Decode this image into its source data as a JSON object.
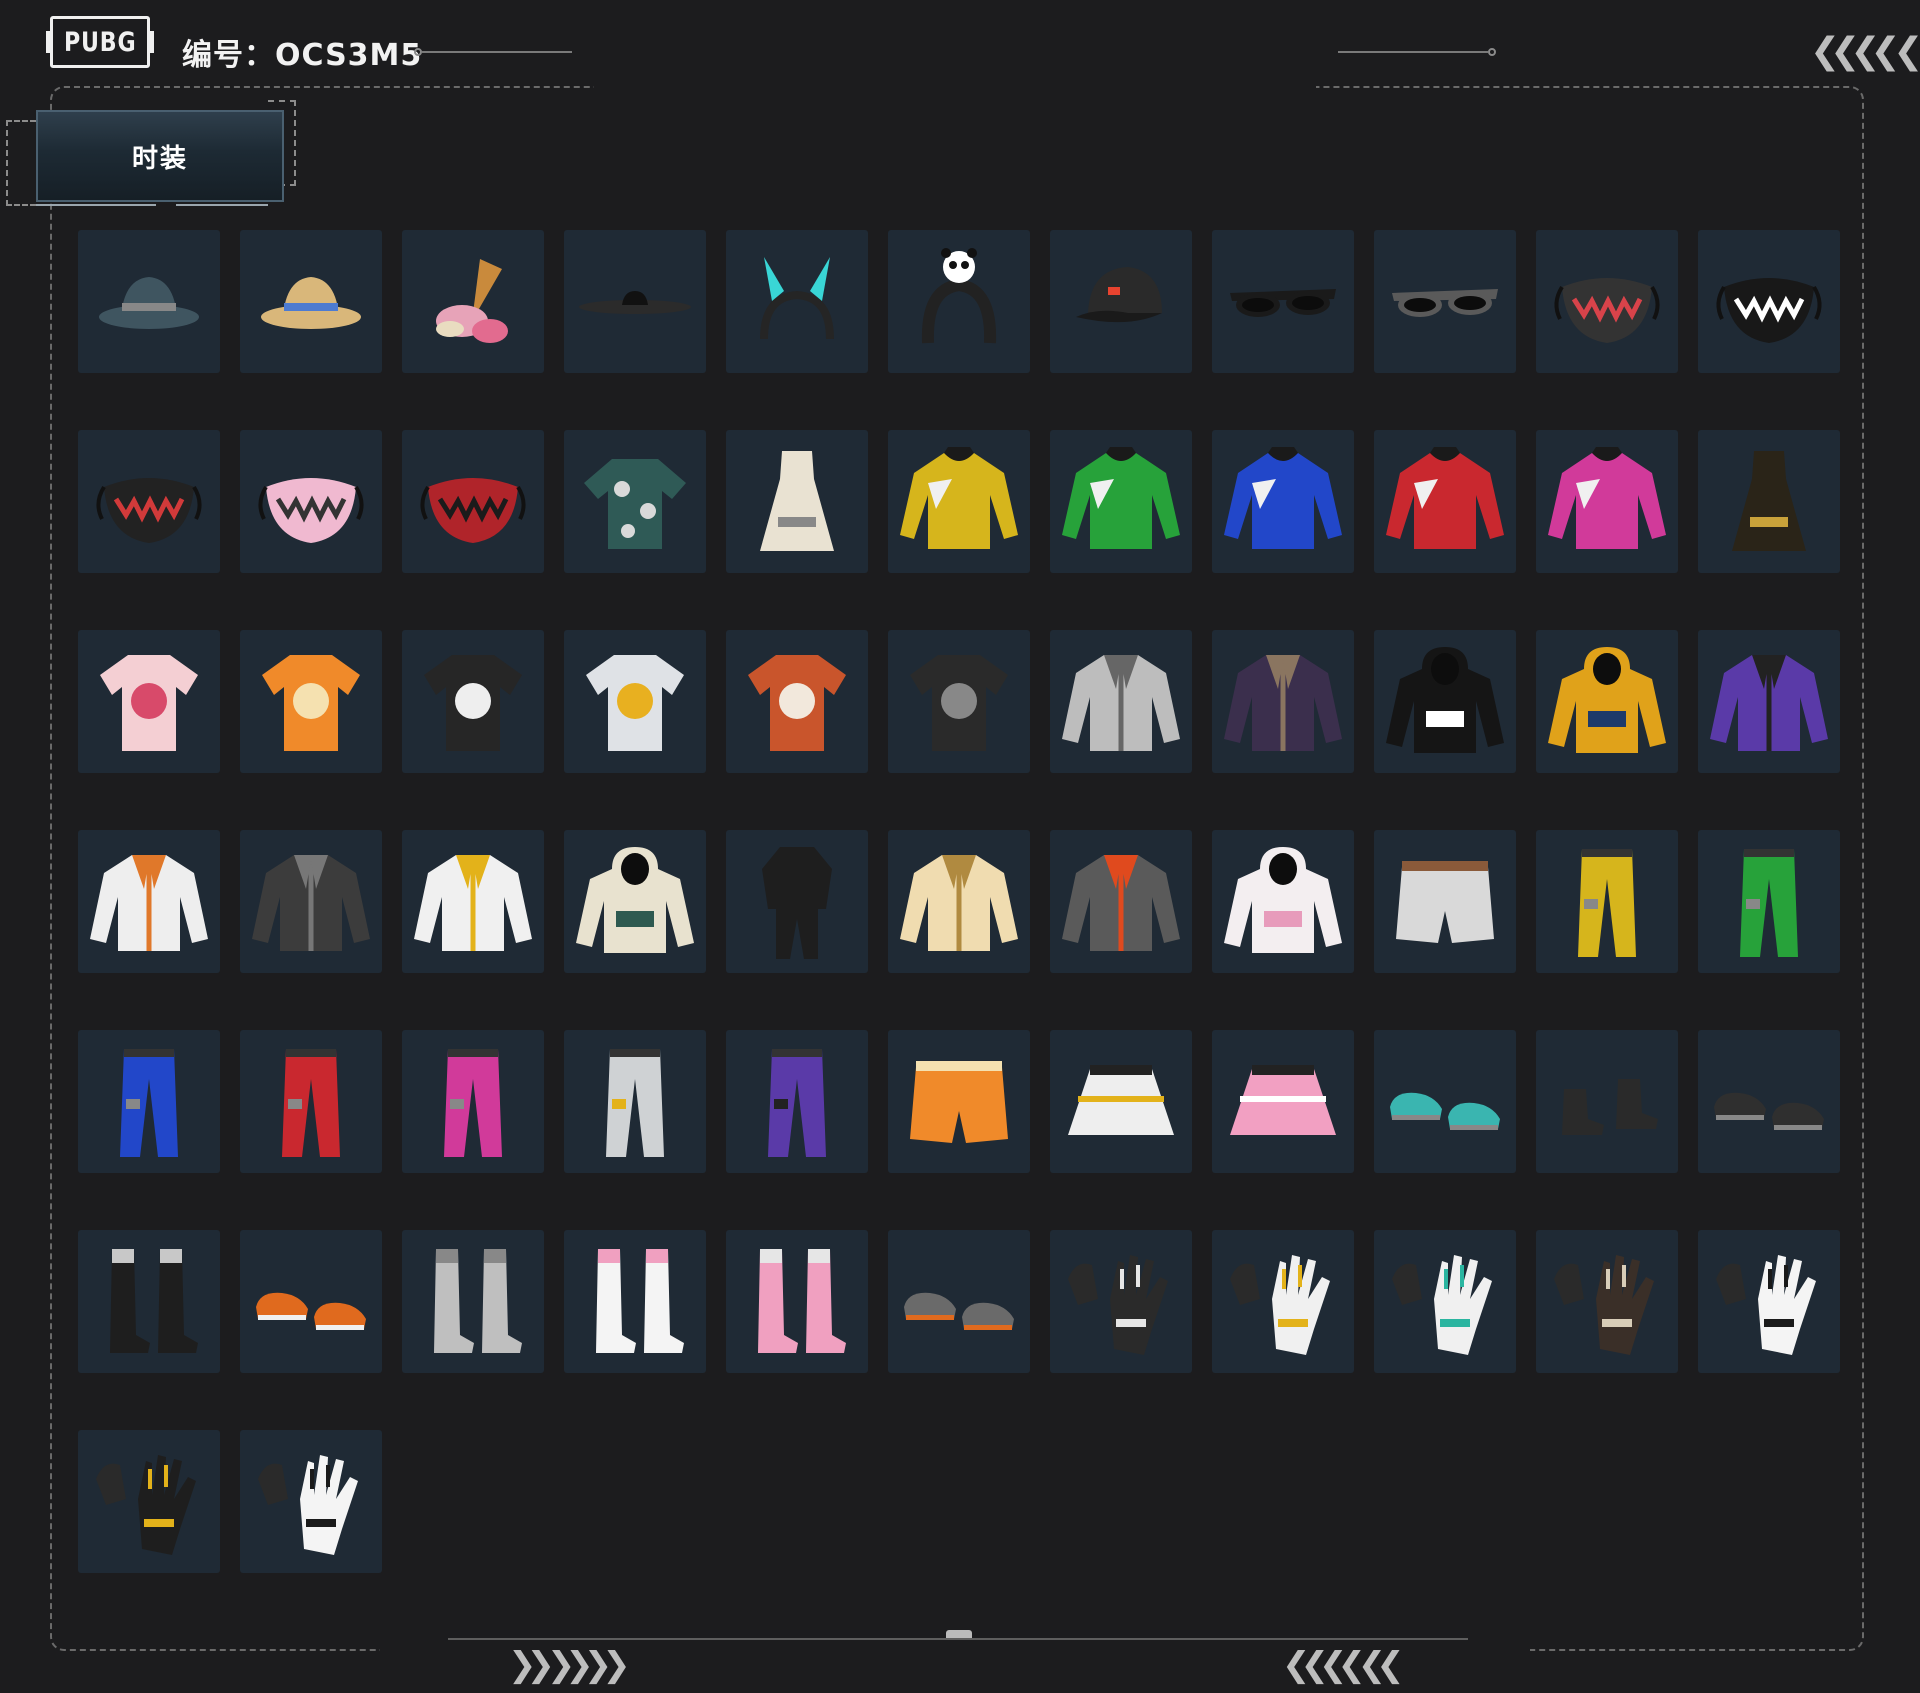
{
  "header": {
    "logo_text": "PUBG",
    "serial_label": "编号：OCS3M5",
    "chevrons_right": "❮❮❮❮ ❮"
  },
  "tabs": [
    {
      "label": "时装"
    }
  ],
  "footer": {
    "chevrons_left": "❯❯ ❯❯❯❯",
    "chevrons_right": "❮❮❮❮ ❮❮"
  },
  "colors": {
    "background": "#1c1c1e",
    "tile": "#1f2a35",
    "tab_top": "#2f3f4c",
    "frame_dash": "#6a6a6a"
  },
  "items": [
    {
      "icon": "bucket-hat-icon",
      "kind": "hat",
      "color": "#3f5560"
    },
    {
      "icon": "straw-hat-icon",
      "kind": "hat",
      "color": "#d9b77a",
      "accent": "#4d7bd1"
    },
    {
      "icon": "ice-cream-hat-icon",
      "kind": "cone",
      "color": "#c98a3c",
      "accent": "#e7a3b8"
    },
    {
      "icon": "wide-brim-hat-icon",
      "kind": "flathat",
      "color": "#2b2b2b"
    },
    {
      "icon": "bunny-ears-headband-icon",
      "kind": "ears",
      "color": "#252525",
      "accent": "#39d6d6"
    },
    {
      "icon": "panda-headband-icon",
      "kind": "headband",
      "color": "#222222",
      "accent": "#ffffff"
    },
    {
      "icon": "baseball-cap-icon",
      "kind": "cap",
      "color": "#2a2a2a",
      "accent": "#e8432f"
    },
    {
      "icon": "sunglasses-icon",
      "kind": "glasses",
      "color": "#1a1a1a"
    },
    {
      "icon": "sunglasses-camo-icon",
      "kind": "glasses",
      "color": "#5a5a5a"
    },
    {
      "icon": "tactical-mask-icon",
      "kind": "mask",
      "color": "#333333",
      "accent": "#d8434a"
    },
    {
      "icon": "teeth-mask-icon",
      "kind": "mask",
      "color": "#181818",
      "accent": "#ffffff"
    },
    {
      "icon": "graffiti-mask-icon",
      "kind": "mask",
      "color": "#222222",
      "accent": "#d23a3a"
    },
    {
      "icon": "pink-face-mask-icon",
      "kind": "mask",
      "color": "#f0b9d0",
      "accent": "#333333"
    },
    {
      "icon": "red-demon-mask-icon",
      "kind": "mask",
      "color": "#b0242a",
      "accent": "#1b1b1b"
    },
    {
      "icon": "floral-shirt-icon",
      "kind": "shirt",
      "color": "#2f5a56",
      "accent": "#d9d9d9"
    },
    {
      "icon": "white-dress-icon",
      "kind": "dress",
      "color": "#e9e2d2"
    },
    {
      "icon": "yellow-jersey-icon",
      "kind": "jersey",
      "color": "#d6b51c"
    },
    {
      "icon": "green-jersey-icon",
      "kind": "jersey",
      "color": "#27a23a"
    },
    {
      "icon": "blue-jersey-icon",
      "kind": "jersey",
      "color": "#2247c9"
    },
    {
      "icon": "red-jersey-icon",
      "kind": "jersey",
      "color": "#c9282f"
    },
    {
      "icon": "pink-jersey-icon",
      "kind": "jersey",
      "color": "#d13a9a"
    },
    {
      "icon": "qipao-dress-icon",
      "kind": "dress",
      "color": "#2a2418",
      "accent": "#c9a23a"
    },
    {
      "icon": "pink-tshirt-icon",
      "kind": "tshirt",
      "color": "#f4cfd3",
      "accent": "#d84a6a"
    },
    {
      "icon": "tiger-tshirt-icon",
      "kind": "tshirt",
      "color": "#f08a2a",
      "accent": "#f5e1b0"
    },
    {
      "icon": "original-is-back-tshirt-icon",
      "kind": "tshirt",
      "color": "#262626",
      "accent": "#eeeeee"
    },
    {
      "icon": "monster-tshirt-icon",
      "kind": "tshirt",
      "color": "#dfe2e6",
      "accent": "#e8b020"
    },
    {
      "icon": "orange-tshirt-icon",
      "kind": "tshirt",
      "color": "#c9552c",
      "accent": "#f2e8dc"
    },
    {
      "icon": "winner-tshirt-icon",
      "kind": "tshirt",
      "color": "#2a2a2a",
      "accent": "#888888"
    },
    {
      "icon": "silver-jacket-icon",
      "kind": "jacket",
      "color": "#bdbdbd",
      "accent": "#666666"
    },
    {
      "icon": "purple-leather-jacket-icon",
      "kind": "jacket",
      "color": "#3b2f4d",
      "accent": "#8a7560"
    },
    {
      "icon": "black-hoodie-icon",
      "kind": "hoodie",
      "color": "#151515",
      "accent": "#ffffff"
    },
    {
      "icon": "yellow-hoodie-icon",
      "kind": "hoodie",
      "color": "#e0a21a",
      "accent": "#1d3a6a"
    },
    {
      "icon": "purple-camo-jacket-icon",
      "kind": "jacket",
      "color": "#5a3aa8",
      "accent": "#222222"
    },
    {
      "icon": "white-mountain-jacket-icon",
      "kind": "jacket",
      "color": "#eeeeee",
      "accent": "#e0782a"
    },
    {
      "icon": "gray-tracksuit-jacket-icon",
      "kind": "jacket",
      "color": "#3c3c3c",
      "accent": "#777777"
    },
    {
      "icon": "yellow-white-jacket-icon",
      "kind": "jacket",
      "color": "#f0f0f0",
      "accent": "#e3b21a"
    },
    {
      "icon": "cream-hoodie-icon",
      "kind": "hoodie",
      "color": "#e8e2cf",
      "accent": "#2e5a50"
    },
    {
      "icon": "black-suit-icon",
      "kind": "suit",
      "color": "#1e1e1e"
    },
    {
      "icon": "cream-cardigan-icon",
      "kind": "jacket",
      "color": "#f0dcb0",
      "accent": "#b08a40"
    },
    {
      "icon": "gray-orange-jacket-icon",
      "kind": "jacket",
      "color": "#5a5a5a",
      "accent": "#e04a1e"
    },
    {
      "icon": "pink-white-hoodie-icon",
      "kind": "hoodie",
      "color": "#f3eef0",
      "accent": "#e79bbb"
    },
    {
      "icon": "white-shorts-icon",
      "kind": "shorts",
      "color": "#d9d9d9",
      "accent": "#8a5a3a"
    },
    {
      "icon": "yellow-pants-icon",
      "kind": "pants",
      "color": "#d6b51c"
    },
    {
      "icon": "green-pants-icon",
      "kind": "pants",
      "color": "#27a23a"
    },
    {
      "icon": "blue-pants-icon",
      "kind": "pants",
      "color": "#2247c9"
    },
    {
      "icon": "red-pants-icon",
      "kind": "pants",
      "color": "#c9282f"
    },
    {
      "icon": "pink-pants-icon",
      "kind": "pants",
      "color": "#d13a9a"
    },
    {
      "icon": "white-cargo-pants-icon",
      "kind": "pants",
      "color": "#cfd2d4",
      "accent": "#e3b21a"
    },
    {
      "icon": "purple-camo-pants-icon",
      "kind": "pants",
      "color": "#5a3aa8",
      "accent": "#222222"
    },
    {
      "icon": "tiger-shorts-icon",
      "kind": "shorts",
      "color": "#f08a2a",
      "accent": "#f5e1b0"
    },
    {
      "icon": "white-pleated-skirt-icon",
      "kind": "skirt",
      "color": "#eeeeee",
      "accent": "#e3b21a"
    },
    {
      "icon": "pink-pleated-skirt-icon",
      "kind": "skirt",
      "color": "#f2a0c2",
      "accent": "#ffffff"
    },
    {
      "icon": "teal-clogs-icon",
      "kind": "shoes",
      "color": "#3ab5b0"
    },
    {
      "icon": "black-ankle-boots-icon",
      "kind": "boots",
      "color": "#2a2a2a"
    },
    {
      "icon": "black-sneakers-icon",
      "kind": "shoes",
      "color": "#2f2f2f"
    },
    {
      "icon": "fur-boots-icon",
      "kind": "tallboots",
      "color": "#1e1e1e",
      "accent": "#c8c8c8"
    },
    {
      "icon": "orange-sneakers-icon",
      "kind": "shoes",
      "color": "#e06a1e",
      "accent": "#f0f0f0"
    },
    {
      "icon": "gray-thigh-boots-icon",
      "kind": "tallboots",
      "color": "#bfbfbf"
    },
    {
      "icon": "white-pink-boots-icon",
      "kind": "tallboots",
      "color": "#f4f4f4",
      "accent": "#f0a0c0"
    },
    {
      "icon": "pink-fishnet-boots-icon",
      "kind": "tallboots",
      "color": "#f0a0c0",
      "accent": "#e6e6e6"
    },
    {
      "icon": "orange-gray-sneakers-icon",
      "kind": "shoes",
      "color": "#6a6a6a",
      "accent": "#e06a1e"
    },
    {
      "icon": "skeleton-gloves-icon",
      "kind": "gloves",
      "color": "#2a2a2a",
      "accent": "#e6e6e6"
    },
    {
      "icon": "yellow-moto-gloves-icon",
      "kind": "gloves",
      "color": "#f0f0f0",
      "accent": "#e3b21a"
    },
    {
      "icon": "teal-moto-gloves-icon",
      "kind": "gloves",
      "color": "#f0f0f0",
      "accent": "#2ab5a0"
    },
    {
      "icon": "bone-gloves-icon",
      "kind": "gloves",
      "color": "#3a2f28",
      "accent": "#d8cdb8"
    },
    {
      "icon": "white-tattoo-gloves-icon",
      "kind": "gloves",
      "color": "#f4f4f4",
      "accent": "#1a1a1a"
    },
    {
      "icon": "yellow-black-gloves-icon",
      "kind": "gloves",
      "color": "#1e1e1e",
      "accent": "#e3b21a"
    },
    {
      "icon": "panda-gloves-icon",
      "kind": "gloves",
      "color": "#f4f4f4",
      "accent": "#1a1a1a"
    }
  ]
}
